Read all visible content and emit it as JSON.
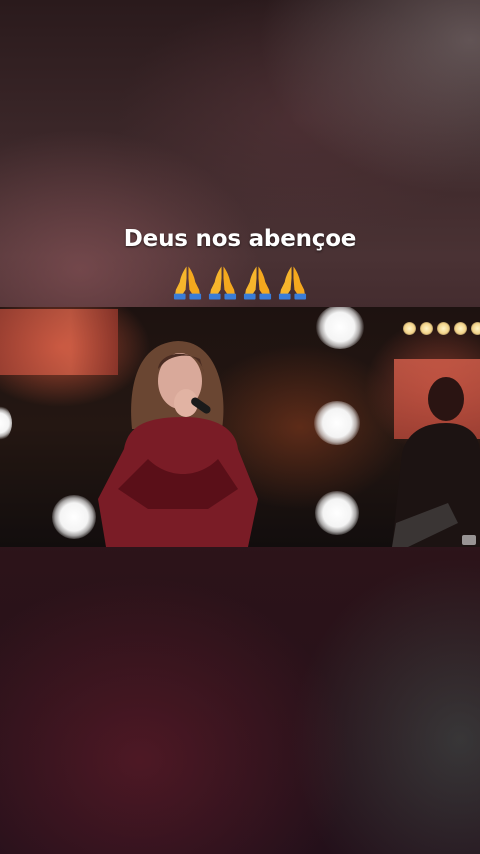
{
  "post": {
    "caption": "Deus nos abençoe",
    "emoji": [
      "folded-hands-icon",
      "folded-hands-icon",
      "folded-hands-icon",
      "folded-hands-icon"
    ]
  },
  "video": {
    "scene": "stage-performance"
  },
  "colors": {
    "background_top": "#4a3234",
    "background_bottom": "#23101a",
    "caption_text": "#ffffff",
    "jacket": "#7a1c26"
  }
}
